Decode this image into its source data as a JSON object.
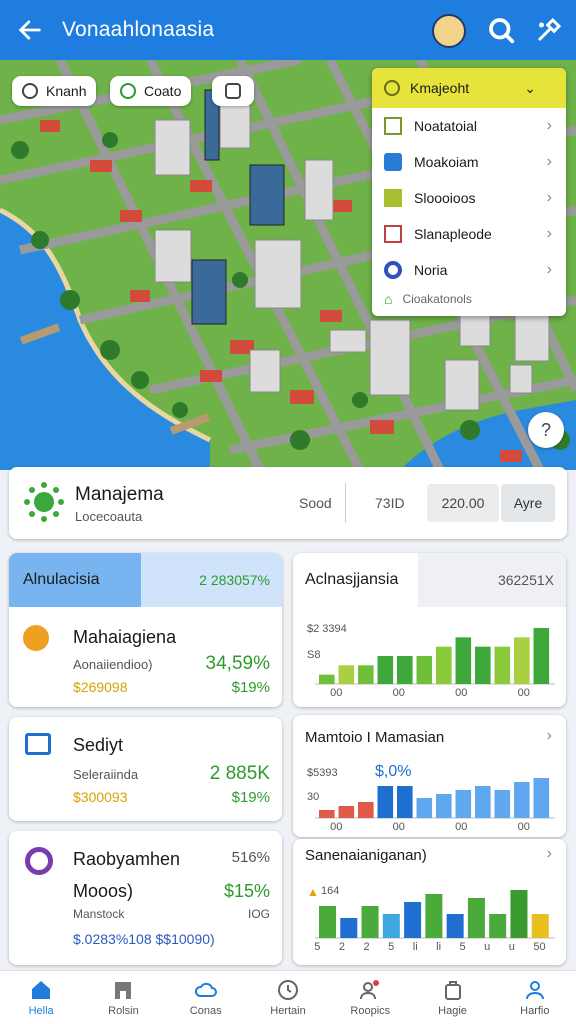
{
  "appbar": {
    "title": "Vonaahlonaasia"
  },
  "map_pills": [
    {
      "label": "Knanh",
      "icon": "heart-icon"
    },
    {
      "label": "Coato",
      "icon": "check-icon"
    },
    {
      "label": "",
      "icon": "square-icon"
    }
  ],
  "dropdown": {
    "header": "Kmajeoht",
    "items": [
      {
        "label": "Noatatoial",
        "icon": "checkbox-icon",
        "color": "#7a9a2a"
      },
      {
        "label": "Moakoiam",
        "icon": "square-blue-icon",
        "color": "#2a7ad8"
      },
      {
        "label": "Sloooioos",
        "icon": "square-green-icon",
        "color": "#a8c030"
      },
      {
        "label": "Slanapleode",
        "icon": "grid-icon",
        "color": "#c04040"
      },
      {
        "label": "Noria",
        "icon": "dot-icon",
        "color": "#3050c0"
      }
    ],
    "footer": "Cioakatonols"
  },
  "summary": {
    "title": "Manajema",
    "subtitle": "Locecoauta",
    "stat1": "Sood",
    "stat2": "73ID",
    "stat3": "220.00",
    "button": "Ayre"
  },
  "cards_left": [
    {
      "header": "Alnulacisia",
      "header_value": "2 283057%",
      "title": "Mahaiagiena",
      "sub": "Aonaiiendioo)",
      "v1": "34,59%",
      "v2": "$269098",
      "v3": "$19%"
    },
    {
      "title": "Sediyt",
      "sub": "Seleraiinda",
      "v1": "2 885K",
      "v2": "$300093",
      "v3": "$19%"
    },
    {
      "title": "Raobyamhen",
      "title_value": "516%",
      "sub2": "Mooos)",
      "v1": "$15%",
      "sub": "Manstock",
      "sub_value": "IOG",
      "footer": "$.0283%108 $$10090)"
    }
  ],
  "cards_right": [
    {
      "title": "Aclnasjjansia",
      "value": "362251X",
      "ylab1": "$2 3394",
      "ylab2": "S8",
      "xlab": [
        "00",
        "00",
        "00",
        "00"
      ]
    },
    {
      "title": "Mamtoio I Mamasian",
      "ylab1": "$5393",
      "ylab2": "30",
      "annot": "$,0%",
      "xlab": [
        "00",
        "00",
        "00",
        "00"
      ]
    },
    {
      "title": "Sanenaianiganan)",
      "ylab1": "164",
      "ylab2": "",
      "xlab": [
        "5",
        "2",
        "2",
        "5",
        "li",
        "li",
        "5",
        "u",
        "u",
        "50"
      ]
    }
  ],
  "chart_data": [
    {
      "type": "bar",
      "values": [
        1,
        2,
        2,
        3,
        3,
        3,
        4,
        5,
        4,
        4,
        5,
        6
      ],
      "colors": [
        "#6fbf3a",
        "#a8d040",
        "#6fbf3a",
        "#3fa83a",
        "#3fa83a",
        "#6fbf3a",
        "#8acb3a",
        "#3fa83a",
        "#3fa83a",
        "#8acb3a",
        "#a8d040",
        "#3fa83a"
      ]
    },
    {
      "type": "bar",
      "values": [
        1,
        1.5,
        2,
        4,
        4,
        2.5,
        3,
        3.5,
        4,
        3.5,
        4.5,
        5
      ],
      "colors": [
        "#e05a4a",
        "#e05a4a",
        "#e05a4a",
        "#1f6fd0",
        "#1f6fd0",
        "#5fa8f0",
        "#5fa8f0",
        "#5fa8f0",
        "#5fa8f0",
        "#5fa8f0",
        "#5fa8f0",
        "#5fa8f0"
      ]
    },
    {
      "type": "bar",
      "values": [
        4,
        2.5,
        4,
        3,
        4.5,
        5.5,
        3,
        5,
        3,
        6,
        3
      ],
      "colors": [
        "#4aaa3a",
        "#1f6fd0",
        "#4aaa3a",
        "#3fa8e0",
        "#1f6fd0",
        "#4aaa3a",
        "#1f6fd0",
        "#4aaa3a",
        "#4aaa3a",
        "#3a9a30",
        "#e8c020"
      ]
    }
  ],
  "nav": [
    {
      "label": "Hella",
      "icon": "home-icon",
      "active": true
    },
    {
      "label": "Rolsin",
      "icon": "building-icon"
    },
    {
      "label": "Conas",
      "icon": "cloud-icon"
    },
    {
      "label": "Hertain",
      "icon": "clock-icon"
    },
    {
      "label": "Roopics",
      "icon": "people-icon"
    },
    {
      "label": "Hagie",
      "icon": "bag-icon"
    },
    {
      "label": "Harfio",
      "icon": "person-icon"
    }
  ]
}
